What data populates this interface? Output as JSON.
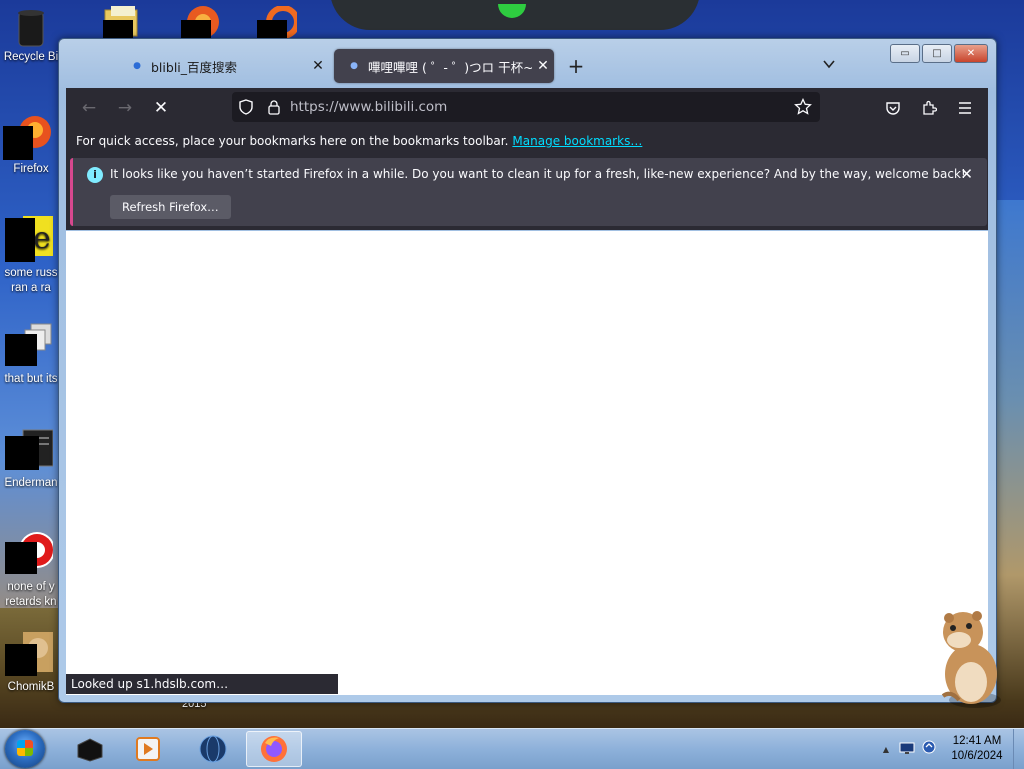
{
  "desktop": {
    "icons": [
      {
        "label": "Recycle Bin",
        "short": "Recycle Bi"
      },
      {
        "label": "Firefox",
        "short": "Firefox"
      },
      {
        "label": "some russ... ran a rat",
        "short": "some russ",
        "line2": "ran a ra"
      },
      {
        "label": "that but its",
        "short": "that but its"
      },
      {
        "label": "Enderman",
        "short": "Enderman"
      },
      {
        "label": "none of y... retards kn",
        "short": "none of y",
        "line2": "retards kn"
      },
      {
        "label": "ChomikB...",
        "short": "ChomikB"
      }
    ],
    "wallpaper_year": "2015"
  },
  "window": {
    "tabs": [
      {
        "title": "blibli_百度搜索",
        "close": "✕",
        "active": false
      },
      {
        "title": "嗶哩嗶哩 ( ゜- ゜)つロ 干杯~-bil",
        "close": "✕",
        "active": true
      }
    ],
    "new_tab": "+",
    "tab_list": "⌄",
    "controls": {
      "minimize": "▭",
      "maximize": "□",
      "close": "✕"
    }
  },
  "navbar": {
    "back": "←",
    "forward": "→",
    "stop": "✕",
    "url": "https://www.bilibili.com",
    "url_scheme": "https://www.",
    "url_domain": "bilibili.com"
  },
  "bookmarks_bar": {
    "text": "For quick access, place your bookmarks here on the bookmarks toolbar.",
    "link": "Manage bookmarks…"
  },
  "notification": {
    "icon": "i",
    "message": "It looks like you haven’t started Firefox in a while. Do you want to clean it up for a fresh, like-new experience? And by the way, welcome back!",
    "button": "Refresh Firefox…",
    "close": "✕"
  },
  "status": "Looked up s1.hdslb.com…",
  "taskbar": {
    "time": "12:41 AM",
    "date": "10/6/2024",
    "tray_arrow": "▲"
  },
  "colors": {
    "chrome_dark": "#2b2a33",
    "urlbar": "#1c1b22",
    "accent_link": "#00ddff",
    "notif_border": "#d7488e",
    "info_icon": "#80ebff"
  }
}
